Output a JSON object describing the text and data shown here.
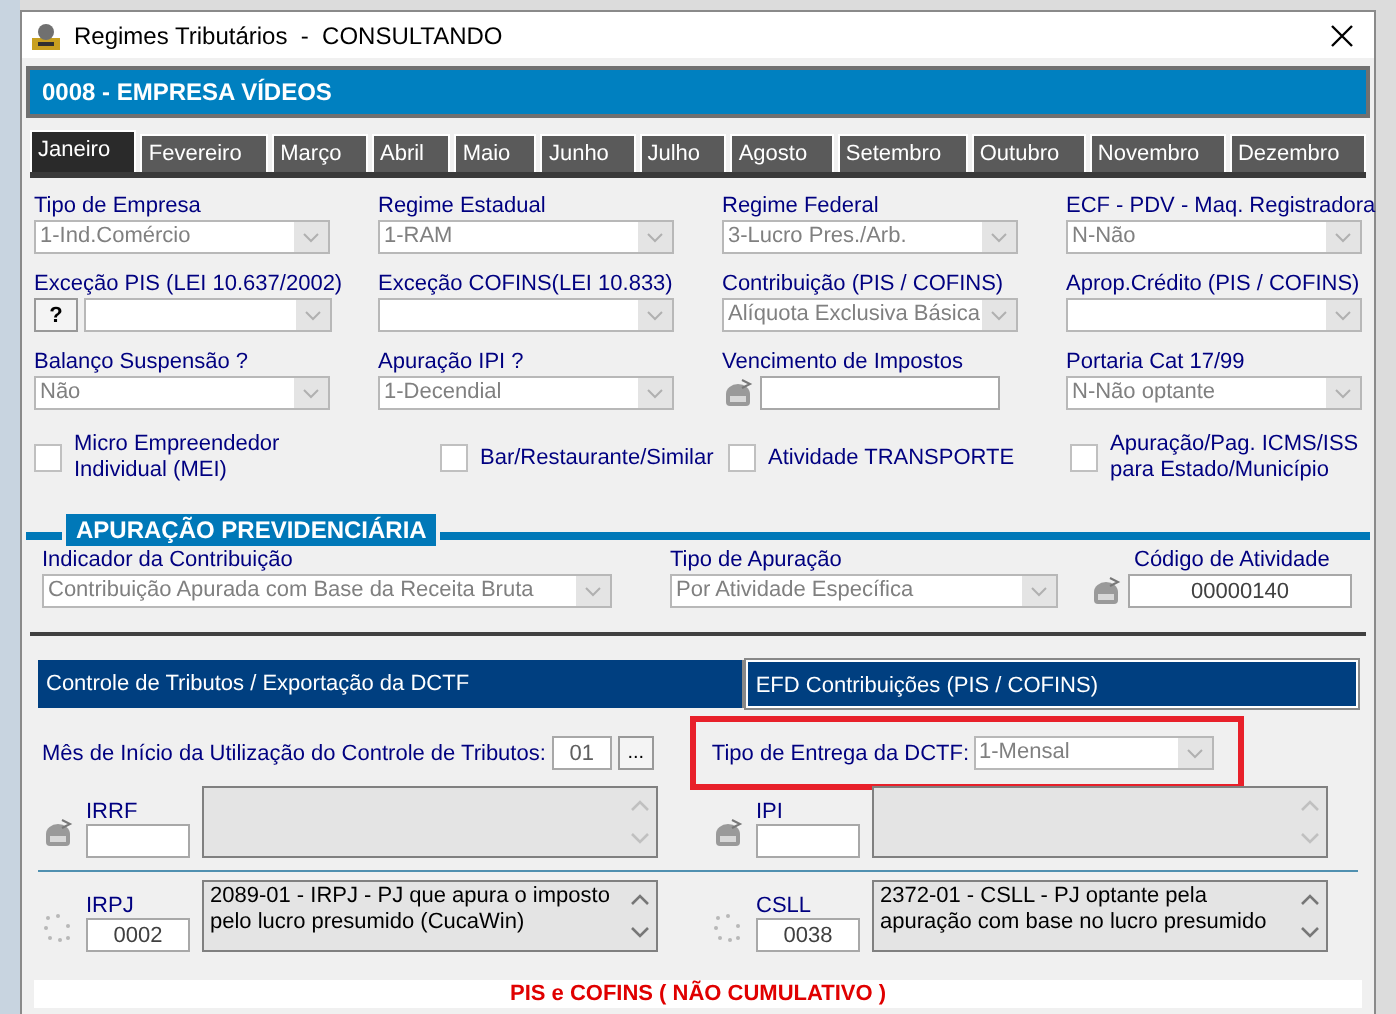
{
  "window": {
    "title": "Regimes Tributários  -  CONSULTANDO"
  },
  "header": {
    "company": "0008 - EMPRESA VÍDEOS"
  },
  "tabs": [
    {
      "label": "Janeiro",
      "selected": true
    },
    {
      "label": "Fevereiro",
      "selected": false
    },
    {
      "label": "Março",
      "selected": false
    },
    {
      "label": "Abril",
      "selected": false
    },
    {
      "label": "Maio",
      "selected": false
    },
    {
      "label": "Junho",
      "selected": false
    },
    {
      "label": "Julho",
      "selected": false
    },
    {
      "label": "Agosto",
      "selected": false
    },
    {
      "label": "Setembro",
      "selected": false
    },
    {
      "label": "Outubro",
      "selected": false
    },
    {
      "label": "Novembro",
      "selected": false
    },
    {
      "label": "Dezembro",
      "selected": false
    }
  ],
  "field_rows": [
    [
      {
        "kind": "select",
        "label": "Tipo de Empresa",
        "value": "1-Ind.Comércio"
      },
      {
        "kind": "select",
        "label": "Regime Estadual",
        "value": "1-RAM"
      },
      {
        "kind": "select",
        "label": "Regime Federal",
        "value": "3-Lucro Pres./Arb."
      },
      {
        "kind": "select",
        "label": "ECF - PDV - Maq. Registradora",
        "value": "N-Não"
      }
    ],
    [
      {
        "kind": "help_select",
        "label": "Exceção PIS (LEI 10.637/2002)",
        "button": "?"
      },
      {
        "kind": "select",
        "label": "Exceção COFINS(LEI 10.833)"
      },
      {
        "kind": "select",
        "label": "Contribuição (PIS / COFINS)",
        "value": "Alíquota Exclusiva Básica"
      },
      {
        "kind": "select",
        "label": "Aprop.Crédito (PIS / COFINS)"
      }
    ],
    [
      {
        "kind": "select",
        "label": "Balanço Suspensão ?",
        "value": "Não"
      },
      {
        "kind": "select",
        "label": "Apuração IPI ?",
        "value": "1-Decendial"
      },
      {
        "kind": "lookup_input",
        "label": "Vencimento de Impostos"
      },
      {
        "kind": "select",
        "label": "Portaria Cat 17/99",
        "value": "N-Não optante"
      }
    ]
  ],
  "checkboxes": [
    {
      "label": "Micro Empreendedor Individual (MEI)",
      "checked": false
    },
    {
      "label": "Bar/Restaurante/Similar",
      "checked": false
    },
    {
      "label": "Atividade TRANSPORTE",
      "checked": false
    },
    {
      "label": "Apuração/Pag. ICMS/ISS para Estado/Município",
      "checked": false
    }
  ],
  "previdenciaria": {
    "title": "APURAÇÃO PREVIDENCIÁRIA",
    "fields": [
      {
        "kind": "select",
        "label": "Indicador da Contribuição",
        "value": "Contribuição Apurada com Base da Receita Bruta"
      },
      {
        "kind": "select",
        "label": "Tipo de Apuração",
        "value": "Por Atividade Específica"
      },
      {
        "kind": "lookup_input",
        "label": "Código de Atividade",
        "value": "00000140"
      }
    ]
  },
  "inner_tabs": [
    {
      "label": "Controle de Tributos / Exportação da DCTF",
      "selected": true
    },
    {
      "label": "EFD Contribuições (PIS / COFINS)",
      "selected": false
    }
  ],
  "dctf": {
    "start_month_label": "Mês de Início da Utilização do Controle de Tributos:",
    "start_month": "01",
    "browse_button": "...",
    "delivery_label": "Tipo de Entrega da DCTF:",
    "delivery_value": "1-Mensal",
    "delivery_highlighted": true
  },
  "tax_rows": [
    [
      {
        "kind": "lookup",
        "name": "IRRF"
      },
      {
        "kind": "lookup",
        "name": "IPI"
      }
    ],
    [
      {
        "kind": "dots",
        "name": "IRPJ",
        "code": "0002",
        "description": "2089-01 - IRPJ - PJ que apura o imposto pelo lucro presumido (CucaWin)"
      },
      {
        "kind": "dots",
        "name": "CSLL",
        "code": "0038",
        "description": "2372-01 - CSLL - PJ optante pela apuração com base no lucro presumido"
      }
    ]
  ],
  "banner": "PIS e COFINS ( NÃO CUMULATIVO )"
}
